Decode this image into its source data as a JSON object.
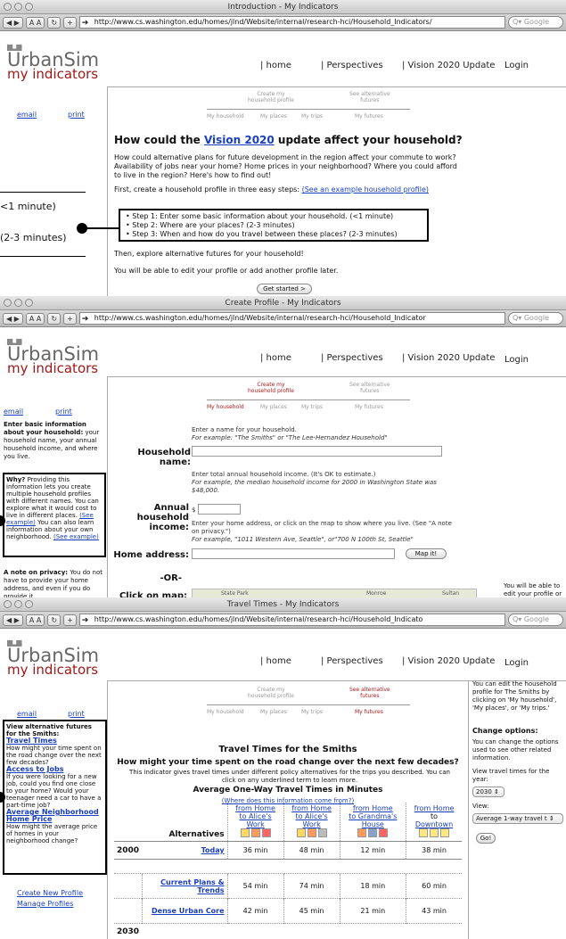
{
  "w1": {
    "title": "Introduction - My Indicators",
    "url": "http://www.cs.washington.edu/homes/jlnd/Website/internal/research-hci/Household_Indicators/",
    "search": "Google"
  },
  "w2": {
    "title": "Create Profile - My Indicators",
    "url": "http://www.cs.washington.edu/homes/jlnd/Website/internal/research-hci/Household_Indicator",
    "search": "Google"
  },
  "w3": {
    "title": "Travel Times - My Indicators",
    "url": "http://www.cs.washington.edu/homes/jlnd/Website/internal/research-hci/Household_Indicato",
    "search": "Google"
  },
  "logo": {
    "top": "UrbanSim",
    "bottom": "my indicators"
  },
  "nav": {
    "home": "| home",
    "perspectives": "| Perspectives",
    "vision": "| Vision 2020 Update",
    "login": "Login"
  },
  "side": {
    "email": "email",
    "print": "print"
  },
  "steps": {
    "create1": "Create my",
    "create2": "household profile",
    "alt1": "See alternative",
    "alt2": "futures",
    "s1": "My household",
    "s2": "My places",
    "s3": "My trips",
    "s4": "My futures"
  },
  "intro": {
    "h_pre": "How could the ",
    "h_link": "Vision 2020",
    "h_post": " update affect your household?",
    "p1": "How could alternative plans for future development in the region affect your commute to work? Availability of jobs near your home? Home prices in your neighborhood? Where you could afford to live in the region? Here's how to find out!",
    "p2_pre": "First, create a household profile in three easy steps: ",
    "p2_link": "(See an example household profile)",
    "step1": "Step 1: Enter some basic information about your household. (<1 minute)",
    "step2": "Step 2: Where are your places? (2-3 minutes)",
    "step3": "Step 3: When and how do you travel between these places? (2-3 minutes)",
    "p3": "Then, explore alternative futures for your household!",
    "p4": "You will be able to edit your profile or add another profile later.",
    "btn": "Get started >",
    "call1": "<1 minute)",
    "call2": "(2-3 minutes)"
  },
  "profile": {
    "side_title": "Enter basic information about your household:",
    "side_body": "your household name, your annual household income, and where you live.",
    "why_title": "Why?",
    "why_body": "Providing this information lets you create multiple household profiles with different names.  You can explore what it would cost to live in different places.",
    "why_link1": "(See example)",
    "why_mid": "You can also learn information about your own neighborhood.",
    "why_link2": "(See example)",
    "priv_title": "A note on privacy:",
    "priv_body": "You do not have to provide your home address, and even if you do provide it,",
    "name_hint1": "Enter a name for your household.",
    "name_hint2": "For example: \"The Smiths\" or \"The Lee-Hernandez Household\"",
    "name_lbl": "Household name:",
    "inc_hint1": "Enter total annual household income. (It's OK to estimate.)",
    "inc_hint2": "For example, the median household income for 2000 in Washington State was $48,000.",
    "inc_lbl1": "Annual household",
    "inc_lbl2": "income:",
    "dollar": "$",
    "addr_hint1": "Enter your home address, or click on the map to show where you live. (See \"A note on privacy.\")",
    "addr_hint2": "For example, \"1011 Western Ave, Seattle\", or\"700 N 100th St, Seattle\"",
    "addr_lbl": "Home address:",
    "mapit": "Map it!",
    "or": "-OR-",
    "click_lbl": "Click on map:",
    "map1": "State Park",
    "map2": "Monroe",
    "map3": "Sultan",
    "right_note": "You will be able to edit your profile or add"
  },
  "travel": {
    "side_title": "View alternative futures for the Smiths:",
    "tt_link": "Travel Times",
    "tt_body": "How might your time spent on the road change over the next few decades?",
    "jobs_link": "Access to Jobs",
    "jobs_body": "If you were looking for a new job, could you find one close to your home? Would your teenager need a car to have a part-time job?",
    "price_link": "Average Neighborhood Home Price",
    "price_body": "How might the average price of homes in your neighborhood change?",
    "create": "Create New Profile",
    "manage": "Manage Profiles",
    "h": "Travel Times for the Smiths",
    "sub": "How might your time spent on the road change over the next few decades?",
    "desc": "This indicator gives travel times under different policy alternatives for the trips you described. You can click on any underlined term to learn more.",
    "th": "Average One-Way Travel Times in Minutes",
    "src": "(Where does this information come from?)",
    "alt": "Alternatives",
    "cols": [
      {
        "a": "from Home",
        "b": "to Alice's",
        "c": "Work"
      },
      {
        "a": "from Home",
        "b": "to Alice's",
        "c": "Work"
      },
      {
        "a": "from Home",
        "b": "to Grandma's",
        "c": "House"
      },
      {
        "a": "from Home",
        "b": "to",
        "c": "Downtown"
      }
    ],
    "y2000": "2000",
    "y2030": "2030",
    "rows": [
      {
        "name": "Today",
        "v": [
          "36 min",
          "48 min",
          "12 min",
          "38 min"
        ]
      },
      {
        "name": "Current Plans & Trends",
        "v": [
          "54 min",
          "74 min",
          "18 min",
          "60 min"
        ]
      },
      {
        "name": "Dense Urban Core",
        "v": [
          "42 min",
          "45 min",
          "21 min",
          "43 min"
        ]
      }
    ],
    "right1": "You can edit the household profile for The Smiths by clicking on 'My household', 'My places', or 'My trips.'",
    "right_h": "Change options:",
    "right2": "You can change the options used to see other related information.",
    "right3": "View travel times for the year:",
    "year": "2030",
    "view": "View:",
    "viewsel": "Average 1-way travel t",
    "go": "Go!"
  }
}
